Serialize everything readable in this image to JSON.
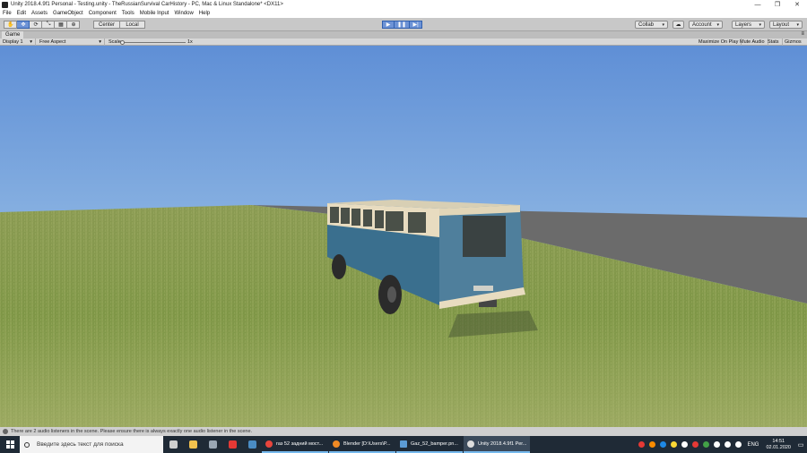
{
  "window": {
    "title": "Unity 2018.4.9f1 Personal - Testing.unity - TheRussianSurvival CarHistory - PC, Mac & Linux Standalone* <DX11>",
    "controls": [
      "—",
      "❐",
      "✕"
    ]
  },
  "menu": [
    "File",
    "Edit",
    "Assets",
    "GameObject",
    "Component",
    "Tools",
    "Mobile Input",
    "Window",
    "Help"
  ],
  "toolbar": {
    "tools": [
      "✋",
      "✥",
      "⟳",
      "⤡",
      "▦",
      "⊕"
    ],
    "pivot": "Center",
    "space": "Local",
    "play_icons": [
      "▶",
      "❚❚",
      "▶|"
    ],
    "collab": "Collab",
    "cloud_icon": "☁",
    "account": "Account",
    "layers": "Layers",
    "layout": "Layout",
    "dropdown_arrow": "▾"
  },
  "game_tab": {
    "label": "Game",
    "menu_glyph": "≡"
  },
  "game_bar": {
    "display": "Display 1",
    "aspect": "Free Aspect",
    "scale_label": "Scale",
    "scale_value": "1x",
    "maximize": "Maximize On Play",
    "mute": "Mute Audio",
    "stats": "Stats",
    "gizmos": "Gizmos"
  },
  "status": {
    "message": "There are 2 audio listeners in the scene. Please ensure there is always exactly one audio listener in the scene."
  },
  "taskbar": {
    "search_placeholder": "Введите здесь текст для поиска",
    "pinned": [
      {
        "name": "task-view-icon",
        "color": "#cfcfcf"
      },
      {
        "name": "file-explorer-icon",
        "color": "#f2c14e"
      },
      {
        "name": "drive-icon",
        "color": "#9aa7b4"
      },
      {
        "name": "yandex-icon",
        "color": "#e53935"
      },
      {
        "name": "steam-icon",
        "color": "#4a8cc4"
      }
    ],
    "apps": [
      {
        "label": "газ 52 задний мост...",
        "color": "#e8453c",
        "active": false
      },
      {
        "label": "Blender [D:\\Users\\P...",
        "color": "#f08a24",
        "active": false
      },
      {
        "label": "Gaz_52_bamper.pn...",
        "color": "#5b9bd5",
        "active": false
      },
      {
        "label": "Unity 2018.4.9f1 Per...",
        "color": "#dddddd",
        "active": true
      }
    ],
    "tray_colors": [
      "#e53935",
      "#fb8c00",
      "#1e88e5",
      "#fdd835",
      "#ffffff",
      "#e53935",
      "#43a047",
      "#ffffff",
      "#ffffff",
      "#ffffff",
      "#bdbdbd"
    ],
    "language": "ENG",
    "time": "14:51",
    "date": "02.01.2020",
    "notification_glyph": "▭"
  }
}
